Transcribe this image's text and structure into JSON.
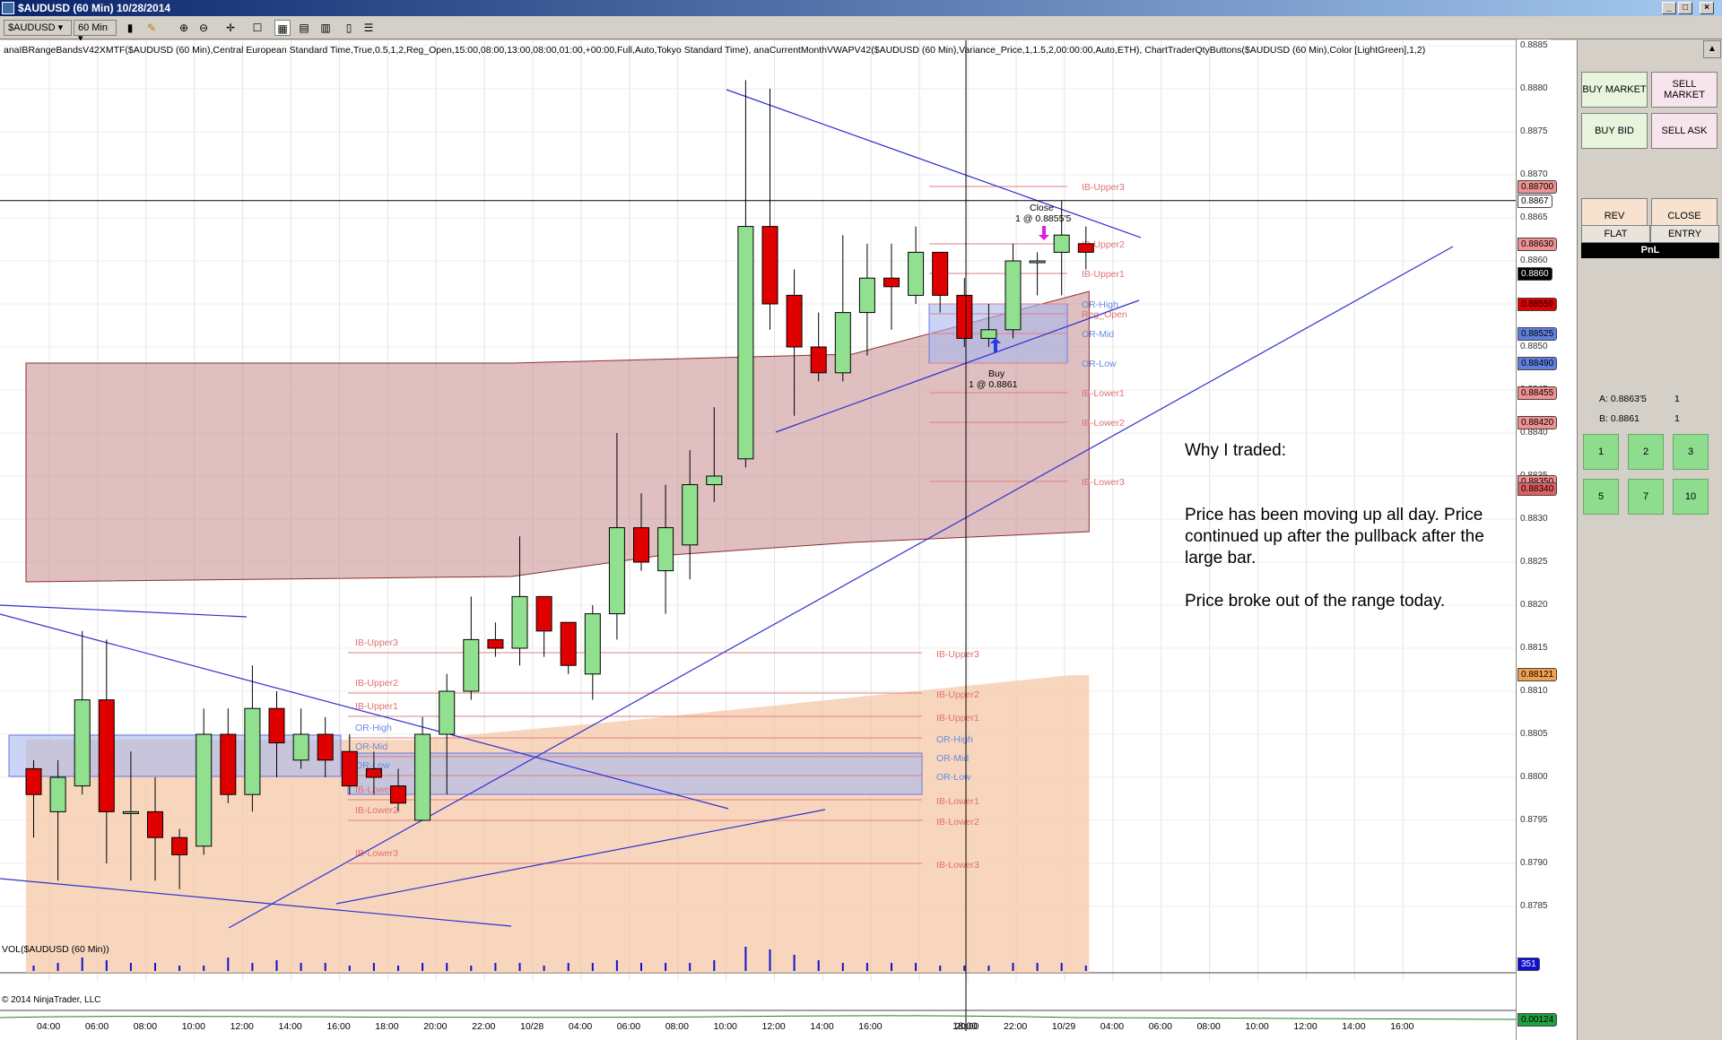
{
  "window": {
    "title": "$AUDUSD (60 Min)  10/28/2014",
    "buttons": [
      "_",
      "□",
      "×"
    ]
  },
  "toolbar": {
    "instrument": "$AUDUSD",
    "period": "60 Min"
  },
  "indicator_line": "anaIBRangeBandsV42XMTF($AUDUSD (60 Min),Central European Standard Time,True,0.5,1,2,Reg_Open,15:00,08:00,13:00,08:00,01:00,+00:00,Full,Auto,Tokyo Standard Time), anaCurrentMonthVWAPV42($AUDUSD (60 Min),Variance_Price,1,1.5,2,00:00:00,Auto,ETH), ChartTraderQtyButtons($AUDUSD (60 Min),Color [LightGreen],1,2)",
  "note": {
    "l1": "Why I traded:",
    "l2": "Price has been moving up all day. Price continued up after the pullback after the large bar.",
    "l3": "Price broke out of the range today."
  },
  "volume_label": "VOL($AUDUSD (60 Min))",
  "volume_badge": "351",
  "lower_label": "© 2014 NinjaTrader, LLC",
  "lower_badge": "0.00124",
  "orders": {
    "close": "Close",
    "close_qty": "1 @ 0.8855'5",
    "buy": "Buy",
    "buy_qty": "1 @ 0.8861"
  },
  "crosshair": {
    "price": "0.8867",
    "time": "18:00"
  },
  "right_panel": {
    "buy_market": "BUY MARKET",
    "sell_market": "SELL MARKET",
    "buy_bid": "BUY BID",
    "sell_ask": "SELL ASK",
    "rev": "REV",
    "close": "CLOSE",
    "flat": "FLAT",
    "entry": "ENTRY",
    "pnl": "PnL",
    "ask": "A: 0.8863'5",
    "ask_qty": "1",
    "bid": "B: 0.8861",
    "bid_qty": "1",
    "qty": [
      "1",
      "2",
      "3",
      "5",
      "7",
      "10"
    ]
  },
  "chart_data": {
    "type": "candlestick",
    "ylim": [
      0.8782,
      0.8886
    ],
    "price_ticks": [
      "0.8885",
      "0.8880",
      "0.8875",
      "0.8870",
      "0.8865",
      "0.8860",
      "0.8855",
      "0.8850",
      "0.8845",
      "0.8840",
      "0.8835",
      "0.8830",
      "0.8825",
      "0.8820",
      "0.8815",
      "0.8810",
      "0.8805",
      "0.8800",
      "0.8795",
      "0.8790",
      "0.8785"
    ],
    "time_ticks": [
      "04:00",
      "06:00",
      "08:00",
      "10:00",
      "12:00",
      "14:00",
      "16:00",
      "18:00",
      "20:00",
      "22:00",
      "10/28",
      "04:00",
      "06:00",
      "08:00",
      "10:00",
      "12:00",
      "14:00",
      "16:00",
      "18:00",
      "20:00",
      "22:00",
      "10/29",
      "04:00",
      "06:00",
      "08:00",
      "10:00",
      "12:00",
      "14:00",
      "16:00"
    ],
    "candles": [
      [
        0.8801,
        0.8798,
        0.8802,
        0.8793
      ],
      [
        0.8796,
        0.88,
        0.8802,
        0.8788
      ],
      [
        0.8799,
        0.8809,
        0.8817,
        0.8798
      ],
      [
        0.8809,
        0.8796,
        0.8816,
        0.879
      ],
      [
        0.8796,
        0.8796,
        0.8803,
        0.8788
      ],
      [
        0.8796,
        0.8793,
        0.88,
        0.8788
      ],
      [
        0.8793,
        0.8791,
        0.8794,
        0.8787
      ],
      [
        0.8792,
        0.8805,
        0.8808,
        0.8791
      ],
      [
        0.8805,
        0.8798,
        0.8808,
        0.8797
      ],
      [
        0.8798,
        0.8808,
        0.8813,
        0.8796
      ],
      [
        0.8808,
        0.8804,
        0.881,
        0.88
      ],
      [
        0.8802,
        0.8805,
        0.8808,
        0.8801
      ],
      [
        0.8805,
        0.8802,
        0.8807,
        0.88
      ],
      [
        0.8803,
        0.8799,
        0.8805,
        0.8798
      ],
      [
        0.8801,
        0.88,
        0.8803,
        0.8798
      ],
      [
        0.8799,
        0.8797,
        0.8801,
        0.8796
      ],
      [
        0.8795,
        0.8805,
        0.8807,
        0.8795
      ],
      [
        0.8805,
        0.881,
        0.8812,
        0.8798
      ],
      [
        0.881,
        0.8816,
        0.8821,
        0.8809
      ],
      [
        0.8816,
        0.8815,
        0.8818,
        0.8814
      ],
      [
        0.8815,
        0.8821,
        0.8828,
        0.8813
      ],
      [
        0.8821,
        0.8817,
        0.8821,
        0.8814
      ],
      [
        0.8818,
        0.8813,
        0.8817,
        0.8812
      ],
      [
        0.8812,
        0.8819,
        0.882,
        0.8809
      ],
      [
        0.8819,
        0.8829,
        0.884,
        0.8816
      ],
      [
        0.8829,
        0.8825,
        0.8833,
        0.8824
      ],
      [
        0.8824,
        0.8829,
        0.8834,
        0.8819
      ],
      [
        0.8827,
        0.8834,
        0.8838,
        0.8823
      ],
      [
        0.8834,
        0.8835,
        0.8843,
        0.8832
      ],
      [
        0.8837,
        0.8864,
        0.8881,
        0.8836
      ],
      [
        0.8864,
        0.8855,
        0.888,
        0.8852
      ],
      [
        0.8856,
        0.885,
        0.8859,
        0.8842
      ],
      [
        0.885,
        0.8847,
        0.8854,
        0.8846
      ],
      [
        0.8847,
        0.8854,
        0.8863,
        0.8846
      ],
      [
        0.8854,
        0.8858,
        0.8862,
        0.8849
      ],
      [
        0.8858,
        0.8857,
        0.8862,
        0.8852
      ],
      [
        0.8856,
        0.8861,
        0.8864,
        0.8855
      ],
      [
        0.8861,
        0.8856,
        0.886,
        0.8854
      ],
      [
        0.8856,
        0.8851,
        0.8858,
        0.885
      ],
      [
        0.8851,
        0.8852,
        0.8855,
        0.885
      ],
      [
        0.8852,
        0.886,
        0.8862,
        0.8851
      ],
      [
        0.886,
        0.886,
        0.8861,
        0.8856
      ],
      [
        0.8861,
        0.8863,
        0.8867,
        0.8856
      ],
      [
        0.8862,
        0.8861,
        0.8864,
        0.8859
      ]
    ],
    "ib_levels_today": [
      {
        "name": "IB-Upper3",
        "value": "0.88700"
      },
      {
        "name": "IB-Upper2",
        "value": "0.88630"
      },
      {
        "name": "IB-Upper1",
        "value": "0.8860"
      },
      {
        "name": "OR-High",
        "value": "0.88559"
      },
      {
        "name": "Reg_Open",
        "value": ""
      },
      {
        "name": "OR-Mid",
        "value": "0.88525"
      },
      {
        "name": "OR-Low",
        "value": "0.88490"
      },
      {
        "name": "IB-Lower1",
        "value": "0.88455"
      },
      {
        "name": "IB-Lower2",
        "value": "0.88420"
      },
      {
        "name": "IB-Lower3",
        "value": "0.88350"
      }
    ],
    "ib_levels_prev": [
      "IB-Upper3",
      "IB-Upper2",
      "IB-Upper1",
      "OR-High",
      "OR-Mid",
      "OR-Low",
      "IB-Lower1",
      "IB-Lower2",
      "IB-Lower3"
    ],
    "extra_badges": [
      "0.88340",
      "0.88121"
    ],
    "volume": [
      2,
      3,
      5,
      4,
      3,
      3,
      2,
      2,
      5,
      3,
      4,
      3,
      3,
      2,
      3,
      2,
      3,
      3,
      2,
      3,
      3,
      2,
      3,
      3,
      4,
      3,
      3,
      3,
      4,
      9,
      8,
      6,
      4,
      3,
      3,
      3,
      3,
      2,
      2,
      2,
      3,
      3,
      3,
      2
    ]
  }
}
